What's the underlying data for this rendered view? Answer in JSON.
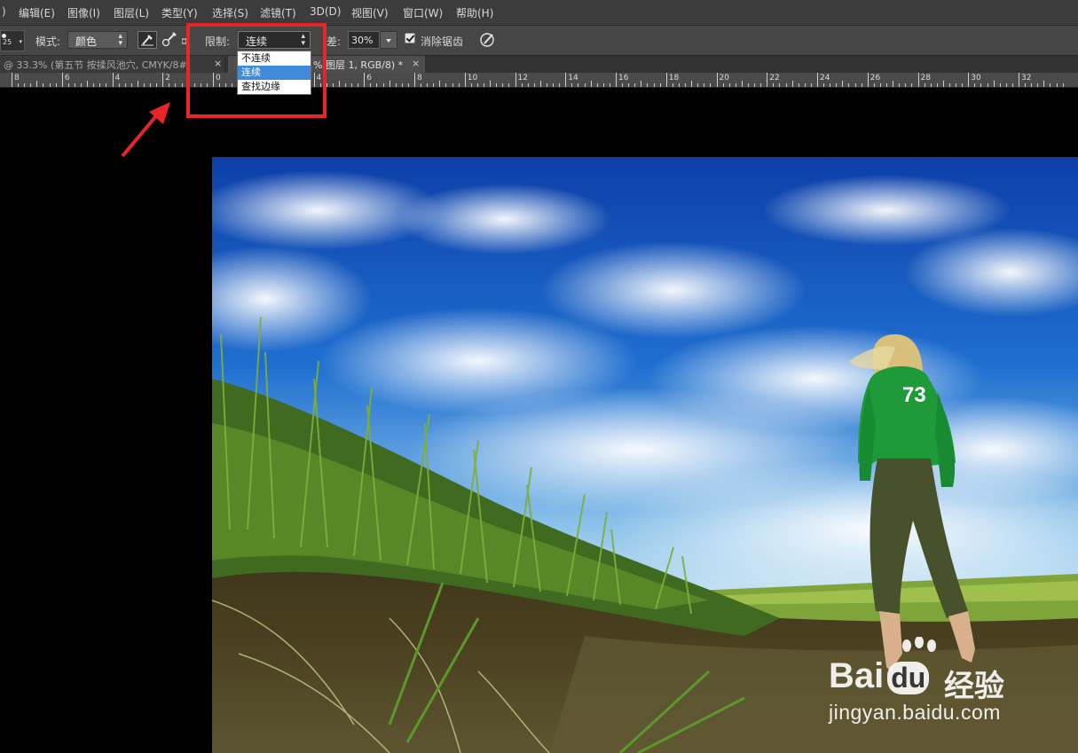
{
  "menubar": {
    "lead": ")",
    "items": [
      "编辑(E)",
      "图像(I)",
      "图层(L)",
      "类型(Y)",
      "选择(S)",
      "滤镜(T)",
      "3D(D)",
      "视图(V)",
      "窗口(W)",
      "帮助(H)"
    ]
  },
  "options": {
    "brush_size": "25",
    "mode_label": "模式:",
    "mode_value": "颜色",
    "limits_label": "限制:",
    "limits_value": "连续",
    "tolerance_label": "容差:",
    "tolerance_value": "30%",
    "antialias_label": "消除锯齿",
    "antialias_checked": true
  },
  "limits_dropdown": {
    "options": [
      "不连续",
      "连续",
      "查找边缘"
    ],
    "selected": "连续"
  },
  "tabs": [
    {
      "label": "@ 33.3% (第五节 按揉风池穴, CMYK/8#)",
      "close": "×",
      "active": false
    },
    {
      "label": "% 图层 1, RGB/8) *",
      "close": "×",
      "active": true
    }
  ],
  "ruler": {
    "labels": [
      "8",
      "6",
      "4",
      "2",
      "0",
      "2",
      "4",
      "6",
      "8",
      "10",
      "12",
      "14",
      "16",
      "18",
      "20",
      "22",
      "24",
      "26",
      "28",
      "30",
      "32"
    ]
  },
  "photo": {
    "jersey_number": "73"
  },
  "watermark": {
    "brand": "Bai",
    "brand2": "du",
    "cn": "经验",
    "url": "jingyan.baidu.com"
  },
  "colors": {
    "highlight_box": "#e8262a",
    "selected_option": "#3e8bd9"
  }
}
